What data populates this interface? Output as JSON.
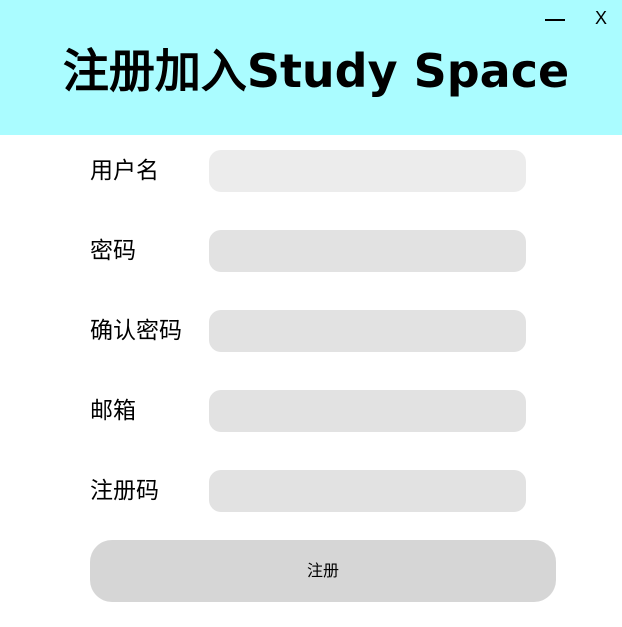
{
  "window": {
    "minimize_label": "",
    "close_label": "X"
  },
  "header": {
    "title": "注册加入Study Space",
    "background": "#aafcff"
  },
  "form": {
    "fields": [
      {
        "label": "用户名",
        "value": "",
        "placeholder": ""
      },
      {
        "label": "密码",
        "value": "",
        "placeholder": ""
      },
      {
        "label": "确认密码",
        "value": "",
        "placeholder": ""
      },
      {
        "label": "邮箱",
        "value": "",
        "placeholder": ""
      },
      {
        "label": "注册码",
        "value": "",
        "placeholder": ""
      }
    ],
    "submit_label": "注册"
  }
}
